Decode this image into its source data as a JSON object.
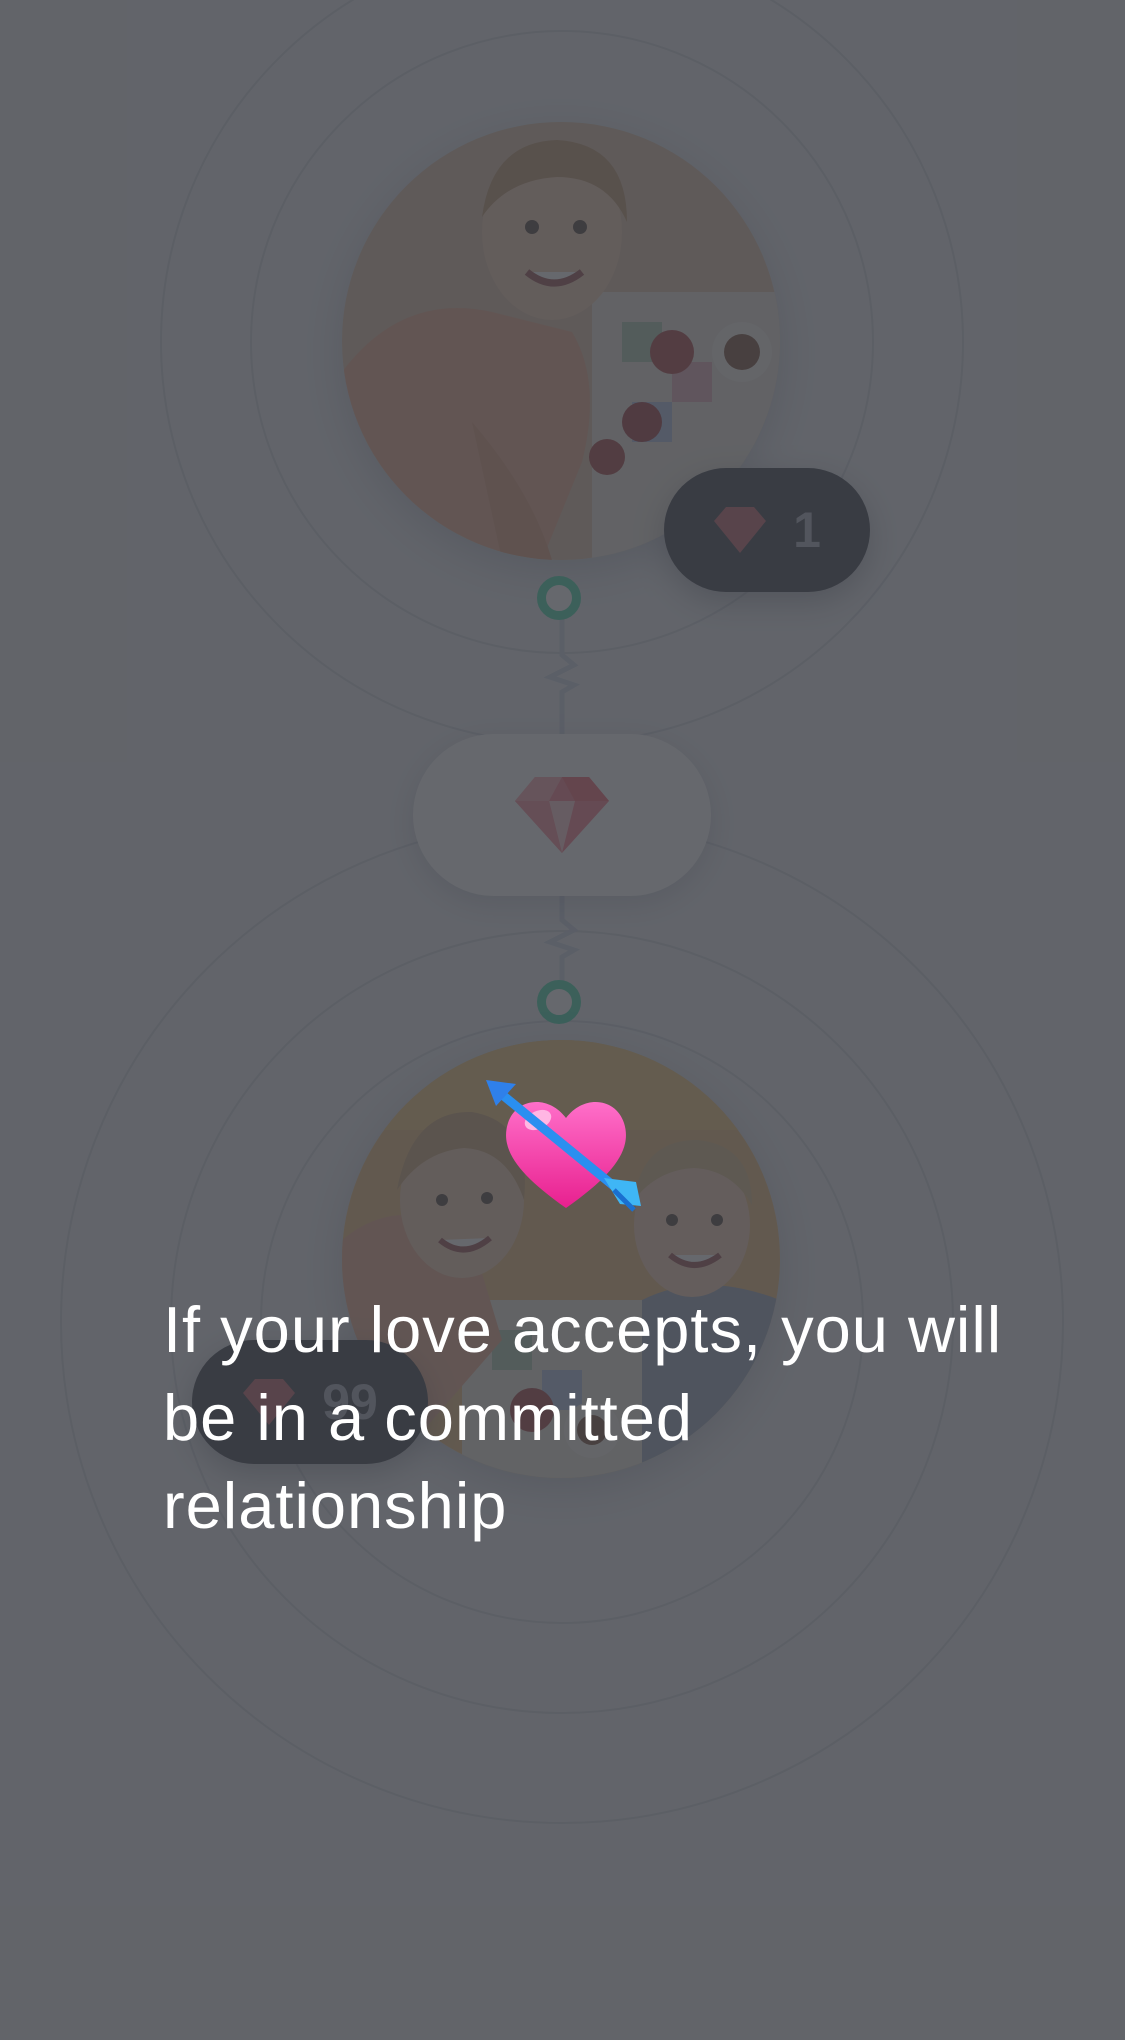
{
  "top_profile": {
    "badge_count": "1",
    "badge_icon": "diamond-icon"
  },
  "center_button": {
    "icon": "diamond-icon",
    "accent_color": "#f76b7c"
  },
  "bottom_profile": {
    "badge_count": "99",
    "badge_icon": "diamond-icon"
  },
  "onboarding": {
    "message": "If your love accepts, you will be in a committed relationship",
    "icon": "heart-with-arrow-icon"
  },
  "colors": {
    "node_ring": "#2dd4a0",
    "badge_bg": "#1f2430",
    "overlay": "#404248"
  }
}
